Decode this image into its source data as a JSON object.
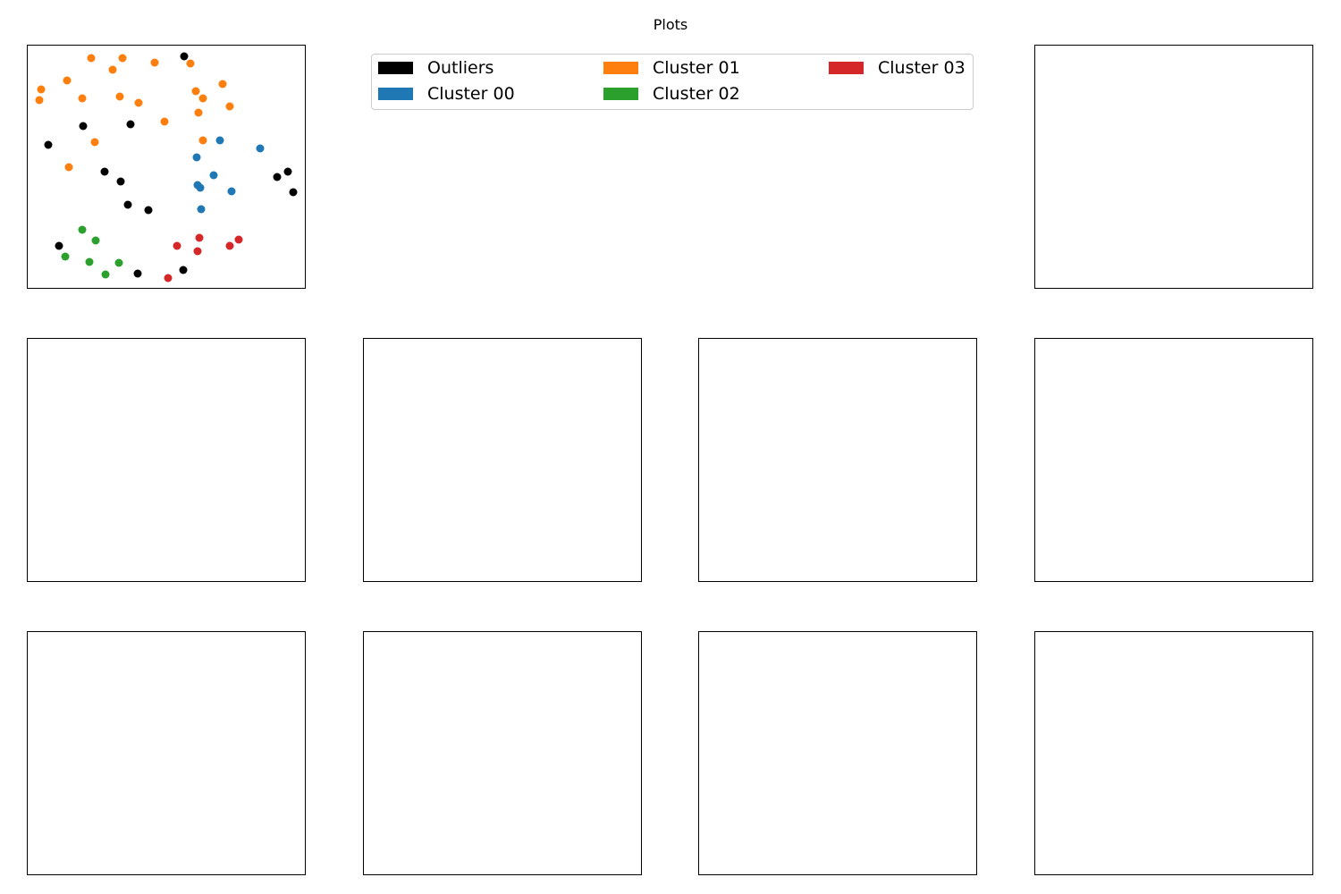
{
  "figure": {
    "title": "Plots"
  },
  "chart_data": [
    {
      "type": "scatter",
      "xlabel": "",
      "ylabel": "",
      "xlim": [
        0,
        310
      ],
      "ylim": [
        0,
        271
      ],
      "axes_ticks": false,
      "grid": false,
      "legend_placement": "separate panel, top-center",
      "series": [
        {
          "name": "Outliers",
          "color": "#000000",
          "points": [
            [
              175,
              259
            ],
            [
              62,
              181
            ],
            [
              115,
              183
            ],
            [
              23,
              160
            ],
            [
              86,
              130
            ],
            [
              104,
              119
            ],
            [
              112,
              93
            ],
            [
              135,
              87
            ],
            [
              279,
              124
            ],
            [
              291,
              130
            ],
            [
              297,
              107
            ],
            [
              35,
              47
            ],
            [
              123,
              16
            ],
            [
              174,
              20
            ]
          ]
        },
        {
          "name": "Cluster 00",
          "color": "#1f77b4",
          "points": [
            [
              215,
              165
            ],
            [
              260,
              156
            ],
            [
              189,
              146
            ],
            [
              208,
              126
            ],
            [
              190,
              115
            ],
            [
              193,
              112
            ],
            [
              228,
              108
            ],
            [
              194,
              88
            ]
          ]
        },
        {
          "name": "Cluster 01",
          "color": "#ff7f0e",
          "points": [
            [
              71,
              257
            ],
            [
              106,
              257
            ],
            [
              142,
              252
            ],
            [
              182,
              251
            ],
            [
              95,
              244
            ],
            [
              44,
              232
            ],
            [
              218,
              228
            ],
            [
              15,
              222
            ],
            [
              188,
              220
            ],
            [
              103,
              214
            ],
            [
              61,
              212
            ],
            [
              196,
              212
            ],
            [
              13,
              210
            ],
            [
              124,
              207
            ],
            [
              226,
              203
            ],
            [
              191,
              196
            ],
            [
              153,
              186
            ],
            [
              196,
              165
            ],
            [
              75,
              163
            ],
            [
              46,
              135
            ]
          ]
        },
        {
          "name": "Cluster 02",
          "color": "#2ca02c",
          "points": [
            [
              61,
              65
            ],
            [
              76,
              53
            ],
            [
              42,
              35
            ],
            [
              69,
              29
            ],
            [
              102,
              28
            ],
            [
              87,
              15
            ]
          ]
        },
        {
          "name": "Cluster 03",
          "color": "#d62728",
          "points": [
            [
              192,
              56
            ],
            [
              236,
              54
            ],
            [
              167,
              47
            ],
            [
              226,
              47
            ],
            [
              190,
              41
            ],
            [
              157,
              11
            ]
          ]
        }
      ]
    },
    {
      "type": "scatter",
      "empty": true
    },
    {
      "type": "scatter",
      "empty": true
    },
    {
      "type": "scatter",
      "empty": true
    },
    {
      "type": "scatter",
      "empty": true
    },
    {
      "type": "scatter",
      "empty": true
    },
    {
      "type": "scatter",
      "empty": true
    },
    {
      "type": "scatter",
      "empty": true
    },
    {
      "type": "scatter",
      "empty": true
    },
    {
      "type": "scatter",
      "empty": true
    }
  ],
  "legend": {
    "items": [
      {
        "label": "Outliers",
        "color": "#000000"
      },
      {
        "label": "Cluster 00",
        "color": "#1f77b4"
      },
      {
        "label": "Cluster 01",
        "color": "#ff7f0e"
      },
      {
        "label": "Cluster 02",
        "color": "#2ca02c"
      },
      {
        "label": "Cluster 03",
        "color": "#d62728"
      }
    ]
  }
}
